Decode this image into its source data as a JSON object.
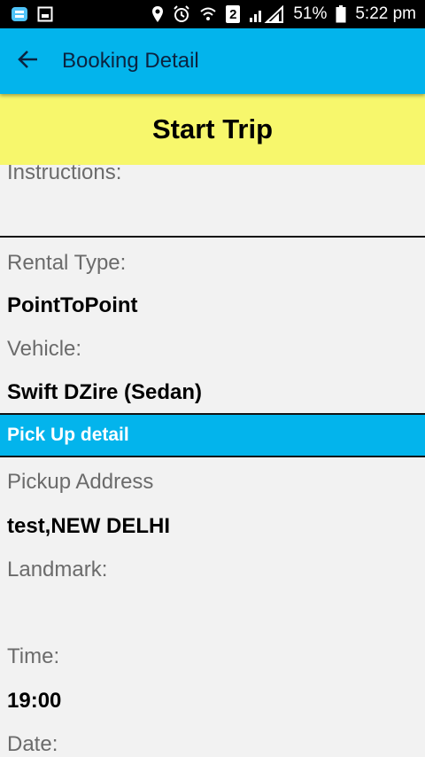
{
  "status_bar": {
    "sim_label": "2",
    "battery": "51%",
    "time": "5:22 pm",
    "icons": [
      "app-notification-icon",
      "image-notification-icon",
      "location-icon",
      "alarm-icon",
      "wifi-icon",
      "sim-icon",
      "signal-icon",
      "battery-icon"
    ]
  },
  "app_bar": {
    "title": "Booking Detail",
    "back_icon": "arrow-left-icon"
  },
  "start_trip_label": "Start Trip",
  "fields": {
    "instructions_label": "Instructions:",
    "rental_type_label": "Rental Type:",
    "rental_type_value": "PointToPoint",
    "vehicle_label": "Vehicle:",
    "vehicle_value": "Swift DZire (Sedan)",
    "pickup_section_title": "Pick Up detail",
    "pickup_address_label": "Pickup Address",
    "pickup_address_value": "test,NEW DELHI",
    "landmark_label": "Landmark:",
    "time_label": "Time:",
    "time_value": "19:00",
    "date_label": "Date:"
  },
  "colors": {
    "app_bar": "#03b4ec",
    "start_trip": "#f7f76c",
    "section_header": "#03b4ec",
    "background": "#f2f2f2"
  }
}
